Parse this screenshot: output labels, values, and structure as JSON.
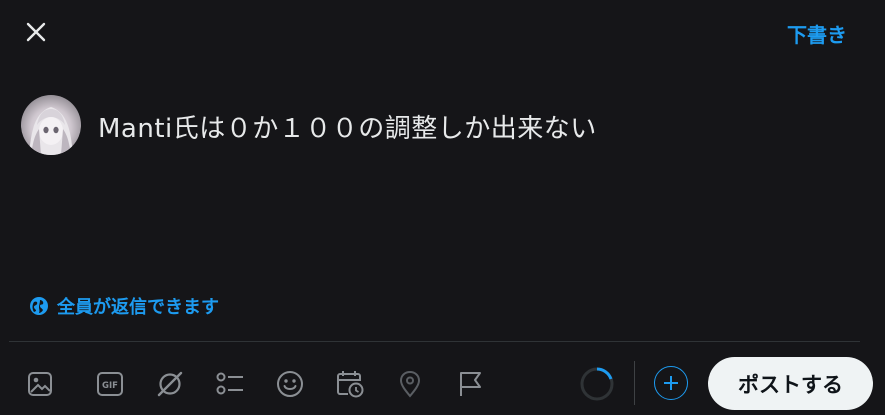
{
  "header": {
    "drafts_label": "下書き"
  },
  "composer": {
    "text": "Manti氏は０か１００の調整しか出来ない"
  },
  "reply_setting": {
    "label": "全員が返信できます"
  },
  "toolbar": {
    "icons": [
      "image-icon",
      "gif-icon",
      "grok-icon",
      "poll-icon",
      "emoji-icon",
      "schedule-icon",
      "location-icon",
      "flag-icon"
    ],
    "gif_label": "GIF",
    "post_label": "ポストする"
  },
  "colors": {
    "accent": "#1d9bf0",
    "background": "#151518",
    "text": "#e7e9ea"
  }
}
